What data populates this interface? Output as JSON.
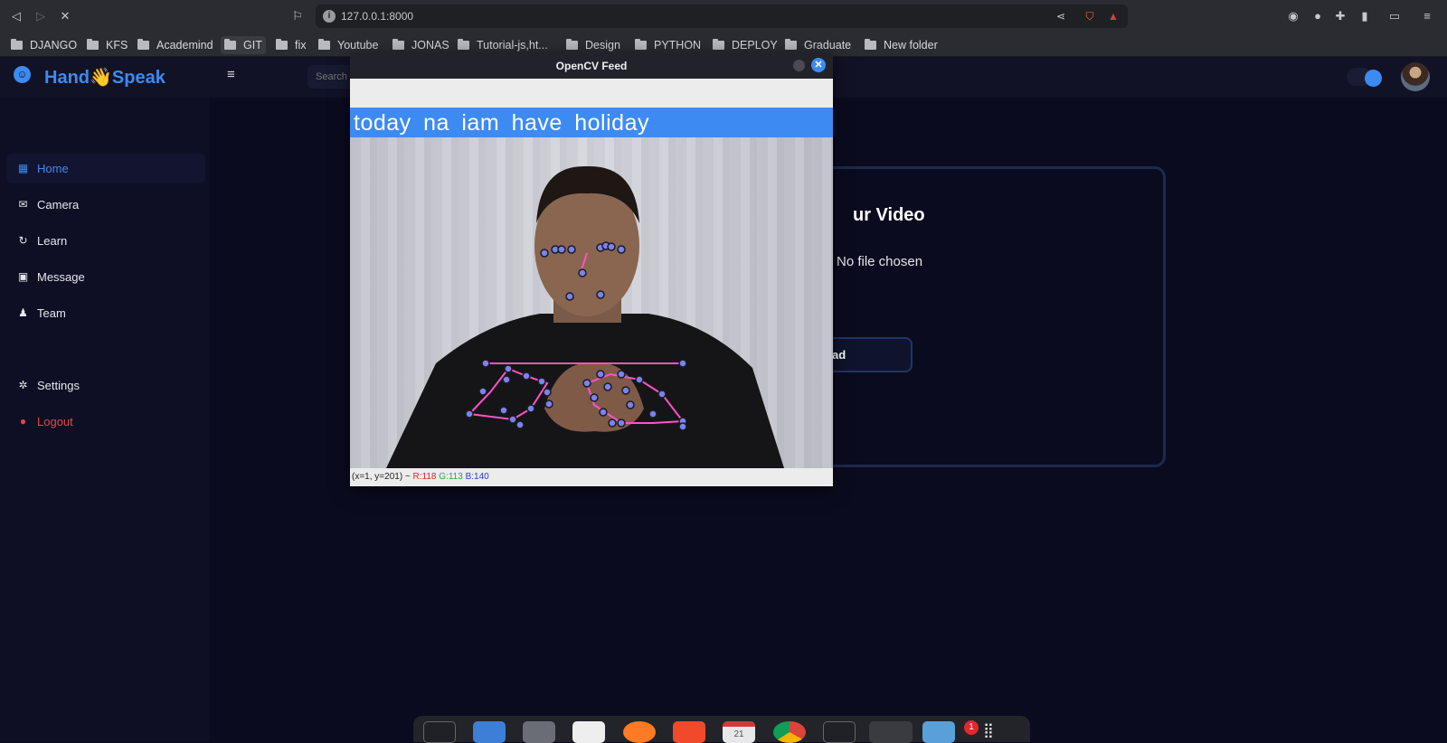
{
  "browser": {
    "url": "127.0.0.1:8000",
    "bookmarks": [
      "DJANGO",
      "KFS",
      "Academind",
      "GIT",
      "fix",
      "Youtube",
      "JONAS",
      "Tutorial-js,ht...",
      "Design",
      "PYTHON",
      "DEPLOY",
      "Graduate",
      "New folder"
    ],
    "nav_icons": [
      "back-icon",
      "forward-icon",
      "stop-icon",
      "bookmark-icon"
    ],
    "right_icons": [
      "share-icon",
      "brave-shields-icon",
      "brave-rewards-icon"
    ],
    "extension_icons": [
      "extension-record-icon",
      "extension-dot-icon",
      "puzzle-icon",
      "sidebar-icon",
      "wallet-icon",
      "menu-icon"
    ]
  },
  "app": {
    "brand_prefix": "Hand",
    "brand_emoji": "👋",
    "brand_suffix": "Speak",
    "search_placeholder": "Search",
    "accent": "#3d8bf2",
    "sidebar": {
      "items": [
        {
          "label": "Home",
          "icon": "grid-icon"
        },
        {
          "label": "Camera",
          "icon": "envelope-icon"
        },
        {
          "label": "Learn",
          "icon": "circle-arrow-icon"
        },
        {
          "label": "Message",
          "icon": "chat-icon"
        },
        {
          "label": "Team",
          "icon": "users-icon"
        },
        {
          "label": "Settings",
          "icon": "gear-icon"
        },
        {
          "label": "Logout",
          "icon": "logout-icon"
        }
      ]
    },
    "upload_card": {
      "title_visible": "ur Video",
      "file_status": "No file chosen",
      "button_visible": "ad"
    }
  },
  "opencv": {
    "title": "OpenCV Feed",
    "caption": "today na iam have holiday",
    "status_prefix": "(x=1, y=201) ~ ",
    "status_r": "R:118",
    "status_g": "G:113",
    "status_b": "B:140"
  },
  "dock": {
    "apps": [
      "terminal-icon",
      "files-icon",
      "calculator-icon",
      "text-editor-icon",
      "firefox-icon",
      "brave-icon",
      "calendar-icon",
      "chrome-icon",
      "terminal-icon",
      "settings-icon",
      "software-icon",
      "app-grid-icon"
    ],
    "calendar_day": "21",
    "badge": "1"
  }
}
